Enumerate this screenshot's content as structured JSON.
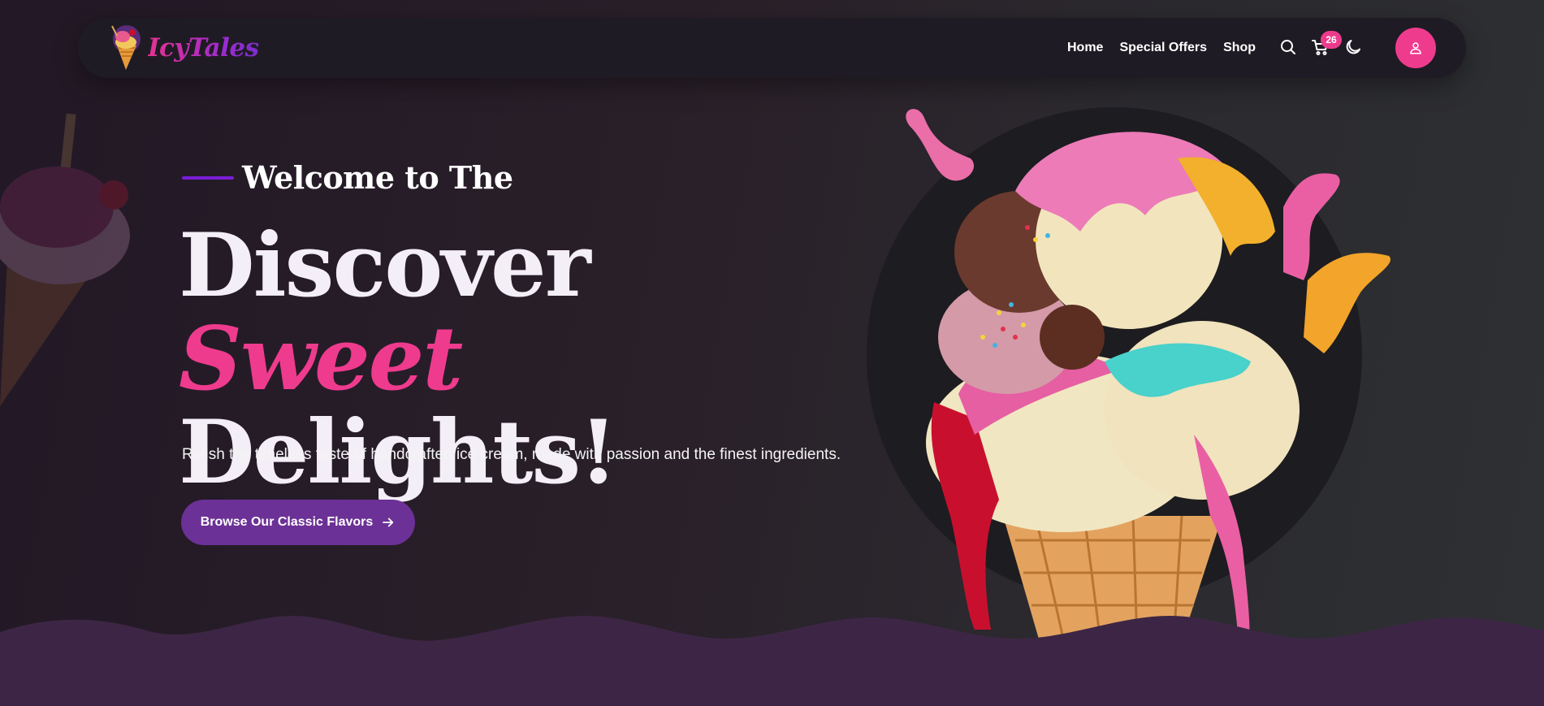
{
  "brand": {
    "name": "IcyTales"
  },
  "nav": {
    "links": [
      "Home",
      "Special Offers",
      "Shop"
    ],
    "cart_count": "26",
    "icons": [
      "search-icon",
      "cart-icon",
      "moon-icon",
      "user-icon"
    ]
  },
  "hero": {
    "eyebrow": "Welcome to The",
    "headline_part1": "Discover",
    "headline_accent": "Sweet",
    "headline_part2": "Delights!",
    "subtext": "Relish the timeless taste of handcrafted ice cream, made with passion and the finest ingredients.",
    "cta_label": "Browse Our Classic Flavors"
  },
  "colors": {
    "accent_pink": "#ef3b8e",
    "brand_purple": "#6b3196",
    "eyebrow_line": "#7a1ed6",
    "wave": "#3d2645",
    "navbar": "#1f1b24"
  }
}
